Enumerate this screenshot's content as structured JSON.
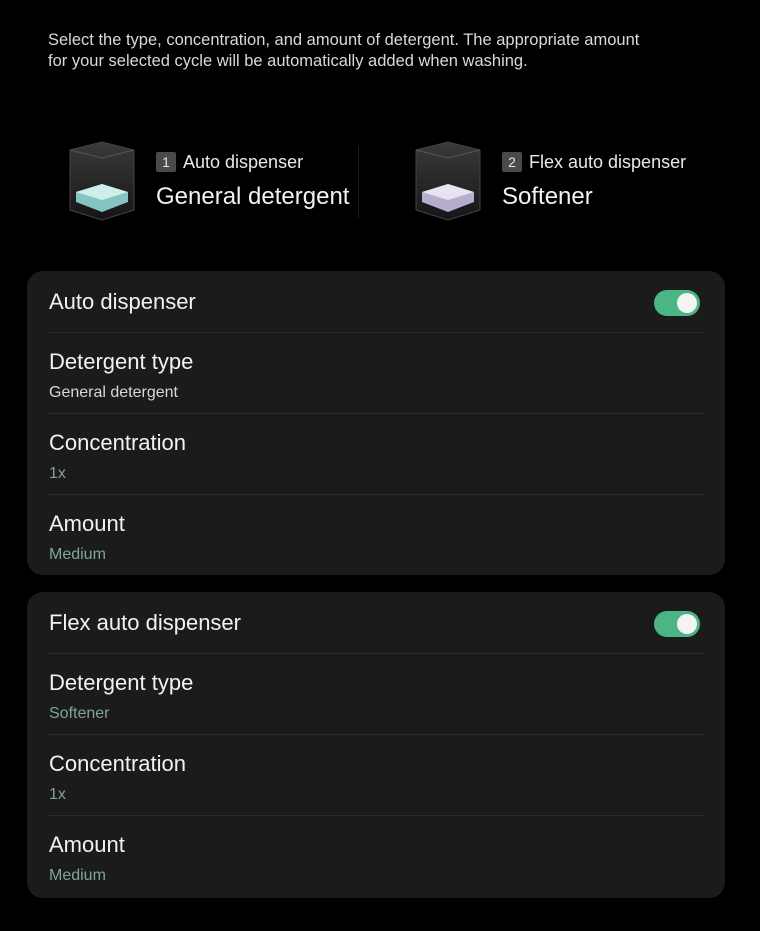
{
  "intro": {
    "line1": "Select the type, concentration, and amount of detergent. The appropriate amount",
    "line2": "for your selected cycle will be automatically added when washing."
  },
  "dispensers": [
    {
      "number": "1",
      "label": "Auto dispenser",
      "content": "General detergent",
      "liquid_color": "#8fd7d3"
    },
    {
      "number": "2",
      "label": "Flex auto dispenser",
      "content": "Softener",
      "liquid_color": "#c8bde0"
    }
  ],
  "cards": [
    {
      "title": "Auto dispenser",
      "toggle_on": true,
      "rows": [
        {
          "title": "Detergent type",
          "value": "General detergent"
        },
        {
          "title": "Concentration",
          "value": "1x"
        },
        {
          "title": "Amount",
          "value": "Medium"
        }
      ]
    },
    {
      "title": "Flex auto dispenser",
      "toggle_on": true,
      "rows": [
        {
          "title": "Detergent type",
          "value": "Softener"
        },
        {
          "title": "Concentration",
          "value": "1x"
        },
        {
          "title": "Amount",
          "value": "Medium"
        }
      ]
    }
  ],
  "colors": {
    "toggle_on": "#4bb583",
    "accent_value": "#7fa596",
    "card_bg": "#1b1b1c"
  }
}
